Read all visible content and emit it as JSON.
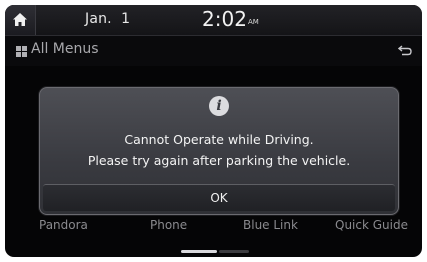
{
  "status_bar": {
    "date": "Jan.  1",
    "time": "2:02",
    "ampm": "AM",
    "home_icon": "home-icon"
  },
  "title_bar": {
    "title": "All Menus",
    "menu_icon": "grid-icon",
    "back_icon": "back-arrow-icon"
  },
  "dialog": {
    "icon": "info-icon",
    "icon_glyph": "i",
    "message_line1": "Cannot Operate while Driving.",
    "message_line2": "Please try again after parking the vehicle.",
    "ok_label": "OK"
  },
  "menu_items": [
    {
      "label": "Pandora"
    },
    {
      "label": "Phone"
    },
    {
      "label": "Blue Link"
    },
    {
      "label": "Quick Guide"
    }
  ],
  "page_indicator": {
    "pages": 2,
    "current": 1
  },
  "colors": {
    "background": "#050506",
    "dialog": "#44454b",
    "text": "#f4f4f4",
    "muted_text": "#8a8a8e"
  }
}
